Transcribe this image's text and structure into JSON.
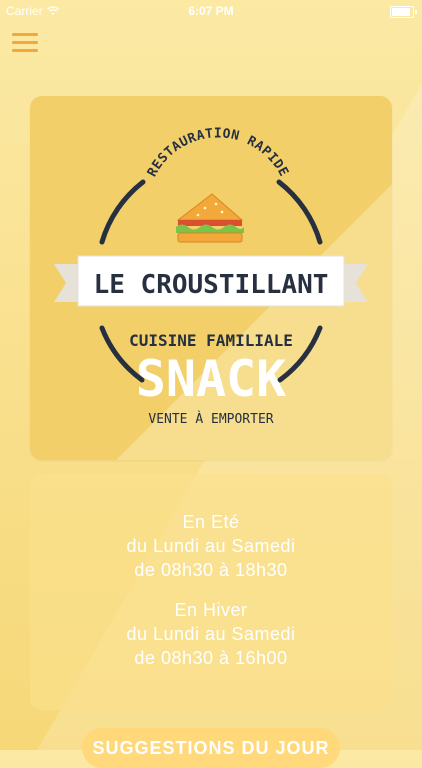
{
  "status_bar": {
    "carrier": "Carrier",
    "time": "6:07 PM",
    "battery_level": 1.0
  },
  "nav": {
    "menu_icon": "hamburger-menu-icon"
  },
  "logo": {
    "top_arc_text": "RESTAURATION RAPIDE",
    "banner_text": "LE CROUSTILLANT",
    "subtitle": "CUISINE FAMILIALE",
    "main_word": "SNACK",
    "tagline": "VENTE À EMPORTER",
    "icon": "sandwich-icon"
  },
  "hours": {
    "summer": {
      "title": "En Eté",
      "days": "du Lundi au Samedi",
      "time": "de 08h30 à 18h30"
    },
    "winter": {
      "title": "En Hiver",
      "days": "du Lundi au Samedi",
      "time": "de 08h30 à 16h00"
    }
  },
  "suggest_button": {
    "label": "SUGGESTIONS DU JOUR"
  },
  "colors": {
    "accent": "#f3a93a",
    "card": "#f2cf69",
    "text_dark": "#263040"
  }
}
